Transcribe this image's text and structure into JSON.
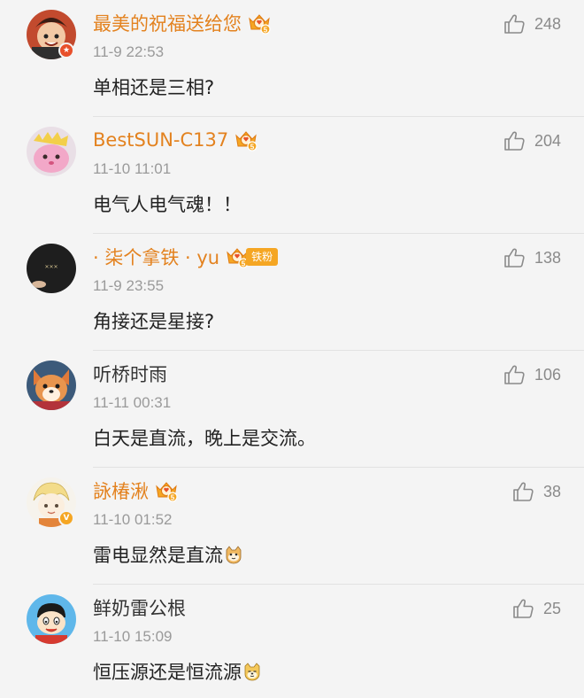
{
  "comments": [
    {
      "name": "最美的祝福送给您",
      "time": "11-9 22:53",
      "text": "单相还是三相?",
      "likes": "248",
      "vip_level": "5",
      "name_color": "#e3821f"
    },
    {
      "name": "BestSUN-C137",
      "time": "11-10 11:01",
      "text": "电气人电气魂！！",
      "likes": "204",
      "vip_level": "5",
      "name_color": "#e3821f"
    },
    {
      "name": "· 柒个拿铁 · yu",
      "time": "11-9 23:55",
      "text": "角接还是星接?",
      "likes": "138",
      "vip_level": "5",
      "fan_badge": "铁粉",
      "name_color": "#e3821f"
    },
    {
      "name": "听桥时雨",
      "time": "11-11 00:31",
      "text": "白天是直流，晚上是交流。",
      "likes": "106",
      "name_color": "#333333"
    },
    {
      "name": "詠椿湫",
      "time": "11-10 01:52",
      "text": "雷电显然是直流",
      "likes": "38",
      "vip_level": "5",
      "emoji": "cat-emoji",
      "name_color": "#e3821f"
    },
    {
      "name": "鲜奶雷公根",
      "time": "11-10 15:09",
      "text": "恒压源还是恒流源",
      "likes": "25",
      "emoji": "doge-emoji",
      "name_color": "#333333"
    }
  ],
  "icons": {
    "like": "thumbs-up-icon",
    "vip": "crown-vip-icon"
  },
  "colors": {
    "accent": "#e3821f",
    "background": "#f4f4f4",
    "muted": "#9a9a9a"
  }
}
